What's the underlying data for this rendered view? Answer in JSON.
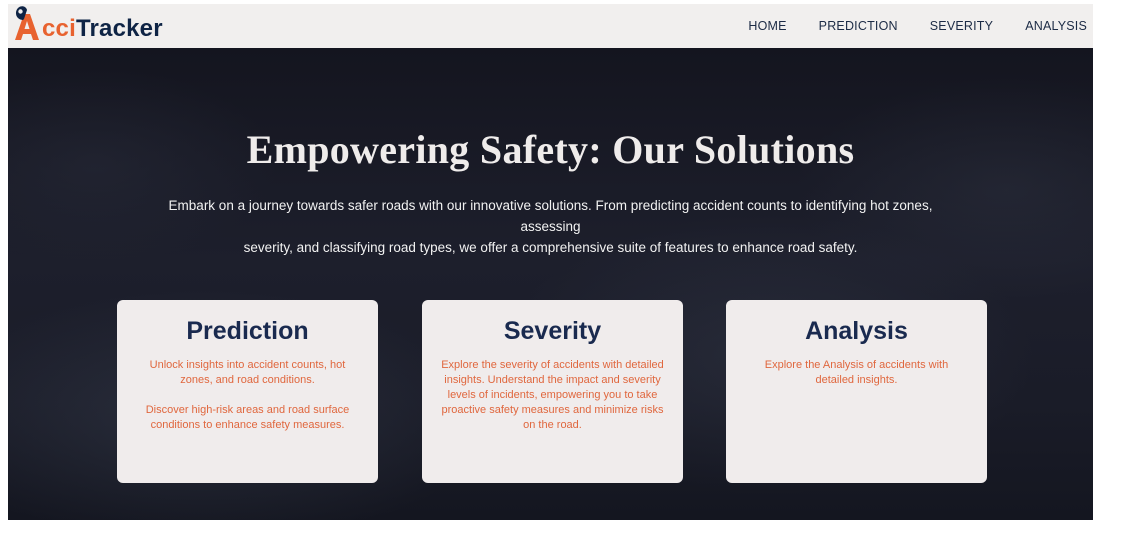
{
  "header": {
    "logo_a": "A",
    "logo_cci": "cci",
    "logo_tracker": "Tracker",
    "nav": [
      "HOME",
      "PREDICTION",
      "SEVERITY",
      "ANALYSIS"
    ]
  },
  "hero": {
    "title": "Empowering Safety: Our Solutions",
    "description_line1": "Embark on a journey towards safer roads with our innovative solutions. From predicting accident counts to identifying hot zones, assessing",
    "description_line2": "severity, and classifying road types, we offer a comprehensive suite of features to enhance road safety."
  },
  "cards": [
    {
      "title": "Prediction",
      "paragraphs": [
        "Unlock insights into accident counts, hot zones, and road conditions.",
        "Discover high-risk areas and road surface conditions to enhance safety measures."
      ]
    },
    {
      "title": "Severity",
      "paragraphs": [
        "Explore the severity of accidents with detailed insights. Understand the impact and severity levels of incidents, empowering you to take proactive safety measures and minimize risks on the road."
      ]
    },
    {
      "title": "Analysis",
      "paragraphs": [
        "Explore the Analysis of accidents with detailed insights."
      ]
    }
  ],
  "colors": {
    "brand_orange": "#e8622f",
    "brand_navy": "#0f2445",
    "card_text": "#e0673e",
    "card_bg": "#f0ecec",
    "nav_bg": "#f1efee",
    "hero_bg": "#1a1c28"
  },
  "icons": {
    "logo": "map-pin-person-icon"
  }
}
